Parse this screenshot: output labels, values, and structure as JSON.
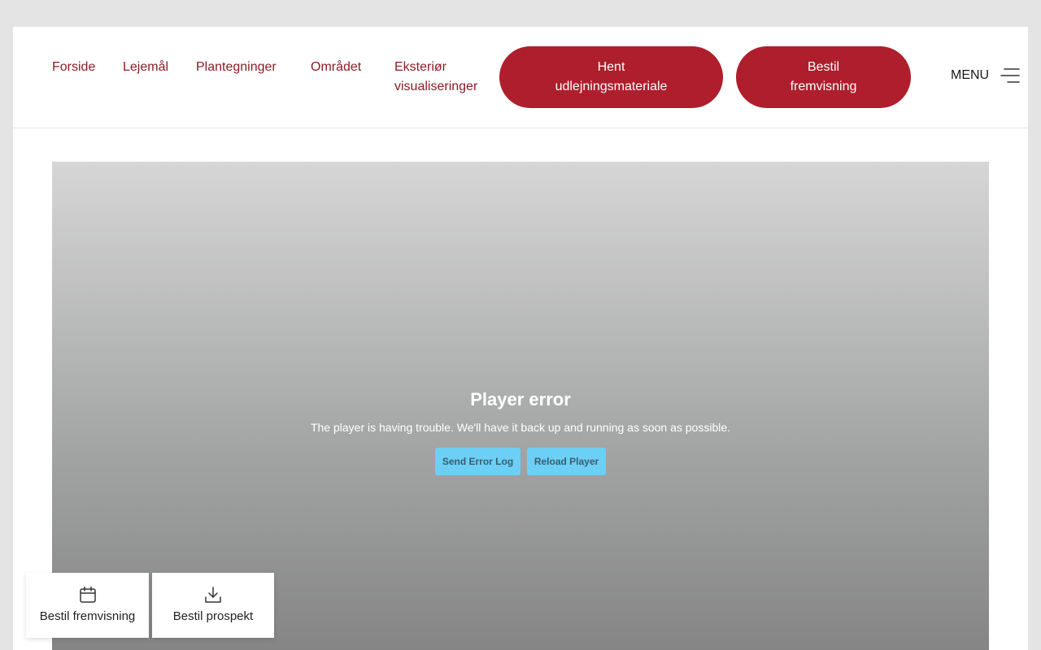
{
  "nav": {
    "links": [
      "Forside",
      "Lejemål",
      "Plantegninger",
      "Området"
    ],
    "exterior_line1": "Eksteriør",
    "exterior_line2": "visualiseringer",
    "cta_primary_line1": "Hent",
    "cta_primary_line2": "udlejningsmateriale",
    "cta_secondary_line1": "Bestil",
    "cta_secondary_line2": "fremvisning",
    "menu_label": "MENU"
  },
  "player": {
    "title": "Player error",
    "message": "The player is having trouble. We'll have it back up and running as soon as possible.",
    "send_log_label": "Send Error Log",
    "reload_label": "Reload Player"
  },
  "floating_actions": {
    "viewing_label": "Bestil fremvisning",
    "prospectus_label": "Bestil prospekt"
  },
  "colors": {
    "brand": "#ae1e2c",
    "nav_link": "#8a1c25",
    "error_button": "#6ccff6",
    "page_background": "#e4e4e4"
  },
  "icons": {
    "menu": "hamburger-icon",
    "viewing": "calendar-icon",
    "prospectus": "download-icon"
  }
}
